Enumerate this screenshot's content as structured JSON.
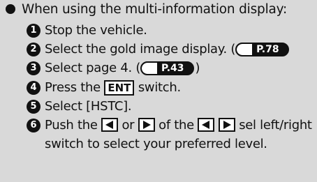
{
  "heading": "When using the multi-information display:",
  "steps": [
    {
      "number": "1",
      "text": "Stop the vehicle."
    },
    {
      "number": "2",
      "text": "Select the gold image display. (",
      "ref": "P.78"
    },
    {
      "number": "3",
      "text": "Select page 4. (",
      "ref": "P.43",
      "close": ")"
    },
    {
      "number": "4",
      "before": "Press the",
      "key": "ENT",
      "after": "switch."
    },
    {
      "number": "5",
      "text": "Select [HSTC]."
    },
    {
      "number": "6",
      "before": "Push the",
      "or": "or",
      "of": "of the",
      "after": "sel left/right switch to select your preferred level."
    }
  ],
  "icons": {
    "left_arrow": "left-triangle-icon",
    "right_arrow": "right-triangle-icon"
  },
  "colors": {
    "background": "#d9d9d9",
    "text": "#111111"
  }
}
